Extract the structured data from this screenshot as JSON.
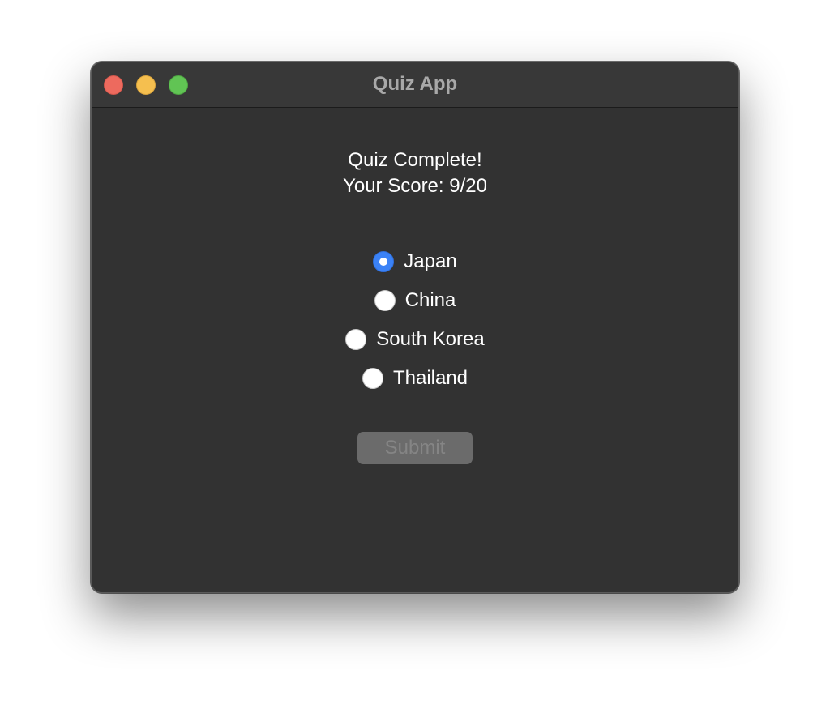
{
  "window": {
    "title": "Quiz App"
  },
  "result": {
    "heading": "Quiz Complete!",
    "score_text": "Your Score: 9/20"
  },
  "options": [
    {
      "label": "Japan",
      "selected": true
    },
    {
      "label": "China",
      "selected": false
    },
    {
      "label": "South Korea",
      "selected": false
    },
    {
      "label": "Thailand",
      "selected": false
    }
  ],
  "submit": {
    "label": "Submit",
    "enabled": false
  },
  "colors": {
    "window_bg": "#323232",
    "radio_selected": "#3b82f6",
    "close": "#ed6a5e",
    "minimize": "#f5bf4f",
    "zoom": "#61c454"
  }
}
